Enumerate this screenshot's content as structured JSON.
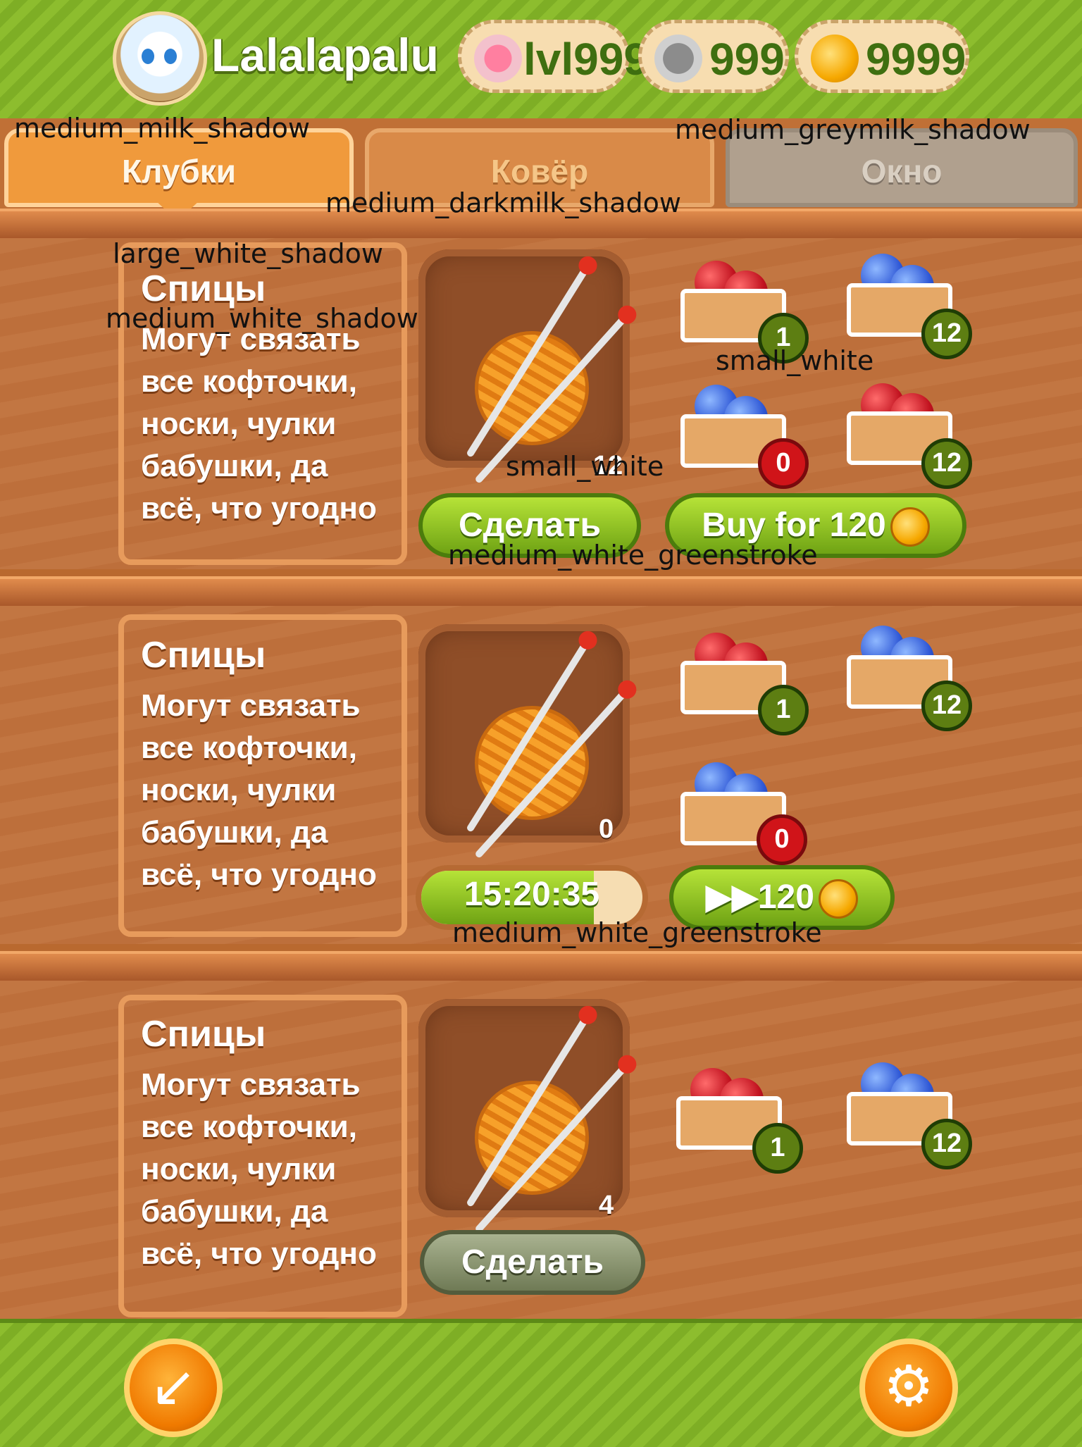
{
  "header": {
    "username": "Lalalapalu",
    "stats": [
      {
        "icon": "paw-icon",
        "value": "lvl999"
      },
      {
        "icon": "mouse-icon",
        "value": "999"
      },
      {
        "icon": "coin-icon",
        "value": "9999"
      }
    ]
  },
  "overlay_labels": {
    "tab1": "medium_milk_shadow",
    "tab3": "medium_greymilk_shadow",
    "tab2": "medium_darkmilk_shadow",
    "title": "large_white_shadow",
    "desc": "medium_white_shadow",
    "badge": "small_white",
    "slotcount": "small_white",
    "button1": "medium_white_greenstroke",
    "button2": "medium_white_greenstroke"
  },
  "tabs": [
    {
      "label": "Клубки",
      "state": "active"
    },
    {
      "label": "Ковёр",
      "state": "inactive"
    },
    {
      "label": "Окно",
      "state": "disabled"
    }
  ],
  "recipes": [
    {
      "title": "Спицы",
      "desc": [
        "Могут связать",
        "все кофточки,",
        "носки, чулки",
        "бабушки, да",
        "всё, что угодно"
      ],
      "count": "12",
      "materials": [
        {
          "type": "red-yarn",
          "count": "1",
          "badge": "green"
        },
        {
          "type": "blue-mouse",
          "count": "12",
          "badge": "green"
        },
        {
          "type": "blue-mouse",
          "count": "0",
          "badge": "red"
        },
        {
          "type": "red-yarn",
          "count": "12",
          "badge": "green"
        }
      ],
      "make_label": "Сделать",
      "buy_label": "Buy for 120"
    },
    {
      "title": "Спицы",
      "desc": [
        "Могут связать",
        "все кофточки,",
        "носки, чулки",
        "бабушки, да",
        "всё, что угодно"
      ],
      "count": "0",
      "materials": [
        {
          "type": "red-yarn",
          "count": "1",
          "badge": "green"
        },
        {
          "type": "blue-mouse",
          "count": "12",
          "badge": "green"
        },
        {
          "type": "blue-mouse",
          "count": "0",
          "badge": "red"
        }
      ],
      "timer": "15:20:35",
      "timer_progress": 0.78,
      "skip_label": "▶▶120"
    },
    {
      "title": "Спицы",
      "desc": [
        "Могут связать",
        "все кофточки,",
        "носки, чулки",
        "бабушки, да",
        "всё, что угодно"
      ],
      "count": "4",
      "materials": [
        {
          "type": "red-yarn",
          "count": "1",
          "badge": "green"
        },
        {
          "type": "blue-mouse",
          "count": "12",
          "badge": "green"
        }
      ],
      "make_label": "Сделать"
    }
  ],
  "footer": {
    "back_icon": "back-arrow-icon",
    "settings_icon": "gear-icon"
  }
}
